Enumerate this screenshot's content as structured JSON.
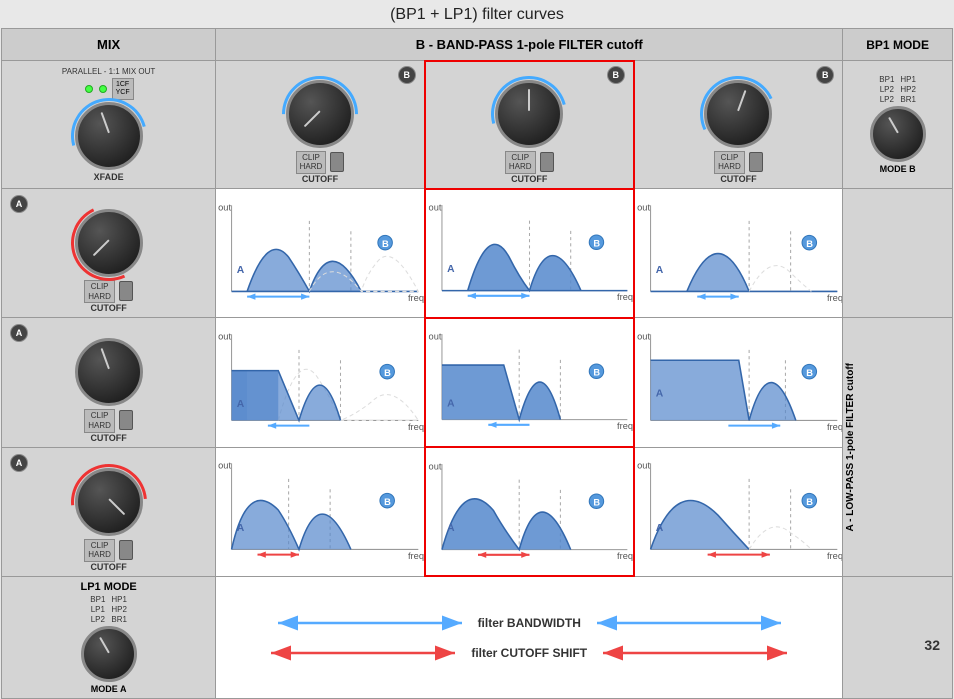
{
  "title": "(BP1 + LP1) filter curves",
  "page_number": "32",
  "header": {
    "mix_label": "MIX",
    "bp_label": "B - BAND-PASS 1-pole FILTER cutoff",
    "mode_label": "BP1 MODE"
  },
  "top_row": {
    "parallel_label": "PARALLEL - 1:1 MIX OUT",
    "xfade_label": "XFADE",
    "cutoff_label": "CUTOFF",
    "clip_hard": "CLIP HARD",
    "mode_b": "MODE B",
    "bp1": "BP1",
    "hp1": "HP1",
    "lp2": "LP2",
    "hp2": "HP2",
    "lp2b": "LP2",
    "br1": "BR1"
  },
  "left_labels": {
    "lp_label": "A - LOW-PASS 1-pole FILTER cutoff"
  },
  "bottom": {
    "lp1_mode": "LP1 MODE",
    "mode_a": "MODE A",
    "bandwidth_label": "filter BANDWIDTH",
    "cutoff_shift_label": "filter CUTOFF SHIFT",
    "bp1": "BP1",
    "hp1": "HP1",
    "lp1": "LP1",
    "hp2": "HP2",
    "lp2": "LP2",
    "br1": "BR1"
  },
  "curve_labels": {
    "out": "out",
    "freq": "freq.",
    "a": "A",
    "b": "B"
  }
}
